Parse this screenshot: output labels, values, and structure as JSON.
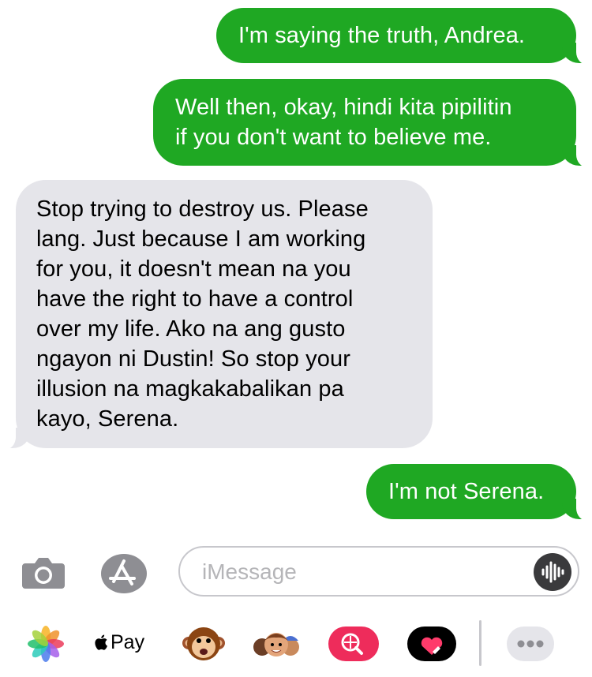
{
  "messages": [
    {
      "direction": "sent",
      "text": "I'm saying the truth, Andrea."
    },
    {
      "direction": "sent",
      "text": "Well then, okay, hindi kita pipilitin\nif you don't want to believe me."
    },
    {
      "direction": "received",
      "text": "Stop trying to destroy us. Please\nlang. Just because I am working\nfor you, it doesn't mean na you\nhave the right to have a control\nover my life. Ako na ang gusto\nngayon ni Dustin! So stop your\nillusion na magkakabalikan pa\nkayo, Serena."
    },
    {
      "direction": "sent",
      "text": "I'm not Serena."
    }
  ],
  "composer": {
    "placeholder": "iMessage",
    "icons": [
      "camera-icon",
      "app-store-icon",
      "audio-message-icon"
    ]
  },
  "app_drawer": {
    "apple_pay_label": "Pay",
    "icons": [
      "photos-icon",
      "apple-pay-icon",
      "animoji-monkey-icon",
      "memoji-icon",
      "image-search-icon",
      "digital-touch-icon",
      "more-icon"
    ]
  },
  "colors": {
    "sent_bubble": "#1fa823",
    "received_bubble": "#e5e5ea",
    "sent_text": "#ffffff",
    "received_text": "#000000"
  }
}
